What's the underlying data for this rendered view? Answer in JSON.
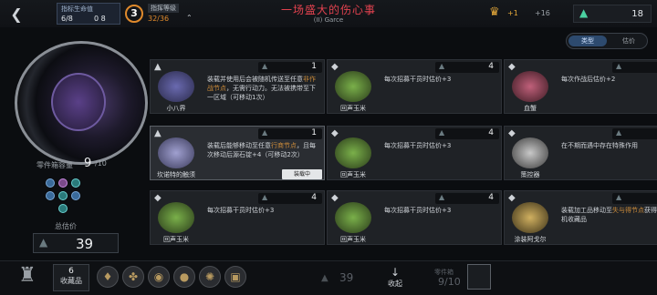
{
  "header": {
    "back_icon": "back-chevron-icon",
    "goal": {
      "label": "指标生命值",
      "current": "6/8",
      "other": "0 8"
    },
    "level": {
      "number": "3",
      "label": "指挥等级",
      "progress": "32/36"
    },
    "title": "一场盛大的伤心事",
    "subtitle": "(II) Garce",
    "resource1": {
      "value_a": "+1",
      "value_b": "+16"
    },
    "resource2": {
      "value": "18"
    }
  },
  "sort_toggle": {
    "active": "类型",
    "inactive": "估价"
  },
  "left_panel": {
    "capacity_label": "零件箱容量",
    "capacity_value": "9",
    "capacity_max": "/10",
    "total_label": "总估价",
    "total_value": "39"
  },
  "cards": [
    {
      "name": "小八界",
      "cost": "1",
      "desc_a": "装载并使用后会被随机传送至任意",
      "desc_hl": "非作战节点",
      "desc_b": "，无需行动力。无法被携带至下一区域（可移动1次）",
      "equipped": ""
    },
    {
      "name": "回声玉米",
      "cost": "4",
      "desc_a": "每次招募干员时估价+3",
      "desc_hl": "",
      "desc_b": "",
      "equipped": ""
    },
    {
      "name": "血蟹",
      "cost": "4",
      "desc_a": "每次作战后估价+2",
      "desc_hl": "",
      "desc_b": "",
      "equipped": ""
    },
    {
      "name": "坎诺特的触须",
      "cost": "1",
      "desc_a": "装载后能够移动至任意",
      "desc_hl": "行商节点",
      "desc_b": "，且每次移动后源石锭+4（可移动2次）",
      "equipped": "装载中"
    },
    {
      "name": "回声玉米",
      "cost": "4",
      "desc_a": "每次招募干员时估价+3",
      "desc_hl": "",
      "desc_b": "",
      "equipped": ""
    },
    {
      "name": "策控器",
      "cost": "4",
      "desc_a": "在不期而遇中存在特殊作用",
      "desc_hl": "",
      "desc_b": "",
      "equipped": ""
    },
    {
      "name": "回声玉米",
      "cost": "4",
      "desc_a": "每次招募干员时估价+3",
      "desc_hl": "",
      "desc_b": "",
      "equipped": ""
    },
    {
      "name": "回声玉米",
      "cost": "4",
      "desc_a": "每次招募干员时估价+3",
      "desc_hl": "",
      "desc_b": "",
      "equipped": ""
    },
    {
      "name": "涂装阿戈尔",
      "cost": "1",
      "desc_a": "装载加工品移动至",
      "desc_hl": "失与得节点",
      "desc_b": "获得2个随机收藏品",
      "equipped": ""
    }
  ],
  "bottom": {
    "collection_count": "6",
    "collection_label": "收藏品",
    "stat_value": "39",
    "collapse_label": "收起",
    "capacity_label": "零件箱",
    "capacity_value": "9/10"
  }
}
